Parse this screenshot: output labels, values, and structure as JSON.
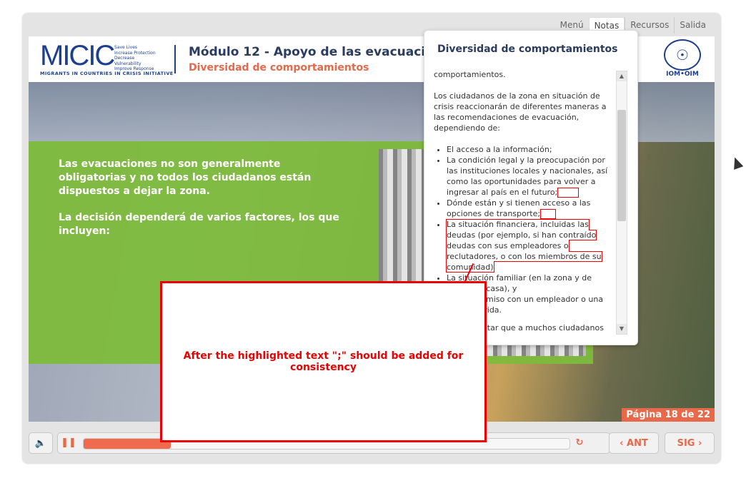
{
  "topnav": [
    "Menú",
    "Notas",
    "Recursos",
    "Salida"
  ],
  "logo": {
    "big": "MICIC",
    "small": [
      "Save Lives",
      "Increase Protection",
      "Decrease Vulnerability",
      "Improve Response"
    ],
    "bottom": "MIGRANTS IN COUNTRIES IN CRISIS INITIATIVE"
  },
  "header": {
    "title": "Módulo 12 - Apoyo de las evacuacione",
    "subtitle": "Diversidad de comportamientos",
    "iom_text": "IOM•OIM"
  },
  "slide": {
    "p1": "Las evacuaciones no son generalmente obligatorias y no todos los ciudadanos están dispuestos a dejar la zona.",
    "p2": "La decisión dependerá de varios factores, los que incluyen:",
    "pagina": "Página 18 de 22"
  },
  "notes": {
    "title": "Diversidad de comportamientos",
    "line0": "comportamientos.",
    "intro": "Los ciudadanos de la zona en situación de crisis reaccionarán de diferentes maneras a las recomendaciones de evacuación, dependiendo de:",
    "b1": "El acceso a la información;",
    "b2": "La condición legal y la preocupación por las instituciones locales y nacionales, así como las oportunidades para volver a ingresar al país en el futuro;",
    "b3": "Dónde están y si tienen acceso a las opciones de transporte;",
    "b4": "La situación financiera, incluidas las deudas (por ejemplo, si han contraído deudas con sus empleadores o reclutadores, o con los miembros de su comunidad)",
    "b5": "La situación familiar (en la zona y de regreso a casa), y",
    "b6": "El compromiso con un empleador o una labor querida.",
    "tail": "Se debe aceptar que a muchos ciudadanos les resultará difícil dejar todo"
  },
  "controls": {
    "progress": 0.18,
    "prev": "ANT",
    "next": "SIG"
  },
  "comment": "After the highlighted text \";\" should be added for consistency"
}
